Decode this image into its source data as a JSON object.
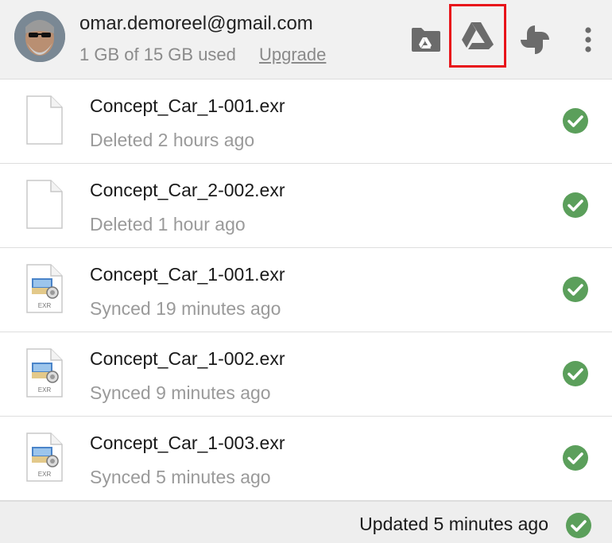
{
  "account": {
    "email": "omar.demoreel@gmail.com",
    "usage": "1 GB of 15 GB used",
    "upgrade_label": "Upgrade"
  },
  "toolbar": {
    "icons": [
      "drive-folder-icon",
      "google-drive-icon",
      "google-photos-icon",
      "more-vert-icon"
    ],
    "highlighted": "google-drive-icon",
    "highlight_color": "#e8131a"
  },
  "files": [
    {
      "name": "Concept_Car_1-001.exr",
      "status": "Deleted 2 hours ago",
      "icon": "blank-document-icon"
    },
    {
      "name": "Concept_Car_2-002.exr",
      "status": "Deleted 1 hour ago",
      "icon": "blank-document-icon"
    },
    {
      "name": "Concept_Car_1-001.exr",
      "status": "Synced 19 minutes ago",
      "icon": "exr-file-icon",
      "icon_label": "EXR"
    },
    {
      "name": "Concept_Car_1-002.exr",
      "status": "Synced 9 minutes ago",
      "icon": "exr-file-icon",
      "icon_label": "EXR"
    },
    {
      "name": "Concept_Car_1-003.exr",
      "status": "Synced 5 minutes ago",
      "icon": "exr-file-icon",
      "icon_label": "EXR"
    }
  ],
  "footer": {
    "status": "Updated 5 minutes ago"
  },
  "colors": {
    "check_green": "#5b9f5b",
    "header_bg": "#f1f1f1",
    "icon_gray": "#6b6b6b"
  }
}
